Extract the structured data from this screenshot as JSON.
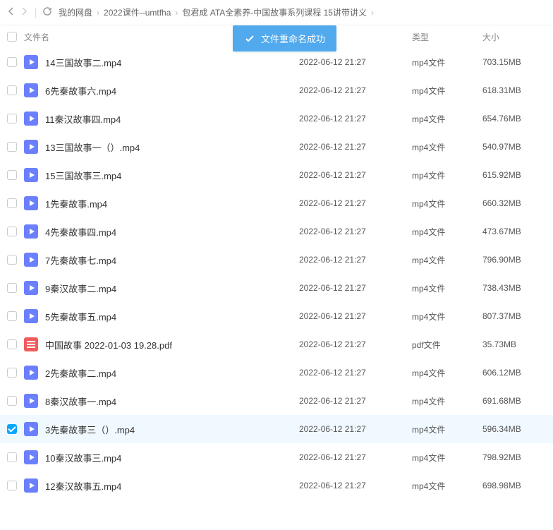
{
  "breadcrumbs": [
    "我的网盘",
    "2022课件--umtfha",
    "包君成 ATA全素养-中国故事系列课程 15讲带讲义"
  ],
  "toast": "文件重命名成功",
  "columns": {
    "name": "文件名",
    "date": "",
    "type": "类型",
    "size": "大小"
  },
  "files": [
    {
      "name": "14三国故事二.mp4",
      "date": "2022-06-12 21:27",
      "type": "mp4文件",
      "size": "703.15MB",
      "icon": "video",
      "checked": false
    },
    {
      "name": "6先秦故事六.mp4",
      "date": "2022-06-12 21:27",
      "type": "mp4文件",
      "size": "618.31MB",
      "icon": "video",
      "checked": false
    },
    {
      "name": "11秦汉故事四.mp4",
      "date": "2022-06-12 21:27",
      "type": "mp4文件",
      "size": "654.76MB",
      "icon": "video",
      "checked": false
    },
    {
      "name": "13三国故事一（）.mp4",
      "date": "2022-06-12 21:27",
      "type": "mp4文件",
      "size": "540.97MB",
      "icon": "video",
      "checked": false
    },
    {
      "name": "15三国故事三.mp4",
      "date": "2022-06-12 21:27",
      "type": "mp4文件",
      "size": "615.92MB",
      "icon": "video",
      "checked": false
    },
    {
      "name": "1先秦故事.mp4",
      "date": "2022-06-12 21:27",
      "type": "mp4文件",
      "size": "660.32MB",
      "icon": "video",
      "checked": false
    },
    {
      "name": "4先秦故事四.mp4",
      "date": "2022-06-12 21:27",
      "type": "mp4文件",
      "size": "473.67MB",
      "icon": "video",
      "checked": false
    },
    {
      "name": "7先秦故事七.mp4",
      "date": "2022-06-12 21:27",
      "type": "mp4文件",
      "size": "796.90MB",
      "icon": "video",
      "checked": false
    },
    {
      "name": "9秦汉故事二.mp4",
      "date": "2022-06-12 21:27",
      "type": "mp4文件",
      "size": "738.43MB",
      "icon": "video",
      "checked": false
    },
    {
      "name": "5先秦故事五.mp4",
      "date": "2022-06-12 21:27",
      "type": "mp4文件",
      "size": "807.37MB",
      "icon": "video",
      "checked": false
    },
    {
      "name": "中国故事 2022-01-03 19.28.pdf",
      "date": "2022-06-12 21:27",
      "type": "pdf文件",
      "size": "35.73MB",
      "icon": "pdf",
      "checked": false
    },
    {
      "name": "2先秦故事二.mp4",
      "date": "2022-06-12 21:27",
      "type": "mp4文件",
      "size": "606.12MB",
      "icon": "video",
      "checked": false
    },
    {
      "name": "8秦汉故事一.mp4",
      "date": "2022-06-12 21:27",
      "type": "mp4文件",
      "size": "691.68MB",
      "icon": "video",
      "checked": false
    },
    {
      "name": "3先秦故事三（）.mp4",
      "date": "2022-06-12 21:27",
      "type": "mp4文件",
      "size": "596.34MB",
      "icon": "video",
      "checked": true
    },
    {
      "name": "10秦汉故事三.mp4",
      "date": "2022-06-12 21:27",
      "type": "mp4文件",
      "size": "798.92MB",
      "icon": "video",
      "checked": false
    },
    {
      "name": "12秦汉故事五.mp4",
      "date": "2022-06-12 21:27",
      "type": "mp4文件",
      "size": "698.98MB",
      "icon": "video",
      "checked": false
    }
  ]
}
